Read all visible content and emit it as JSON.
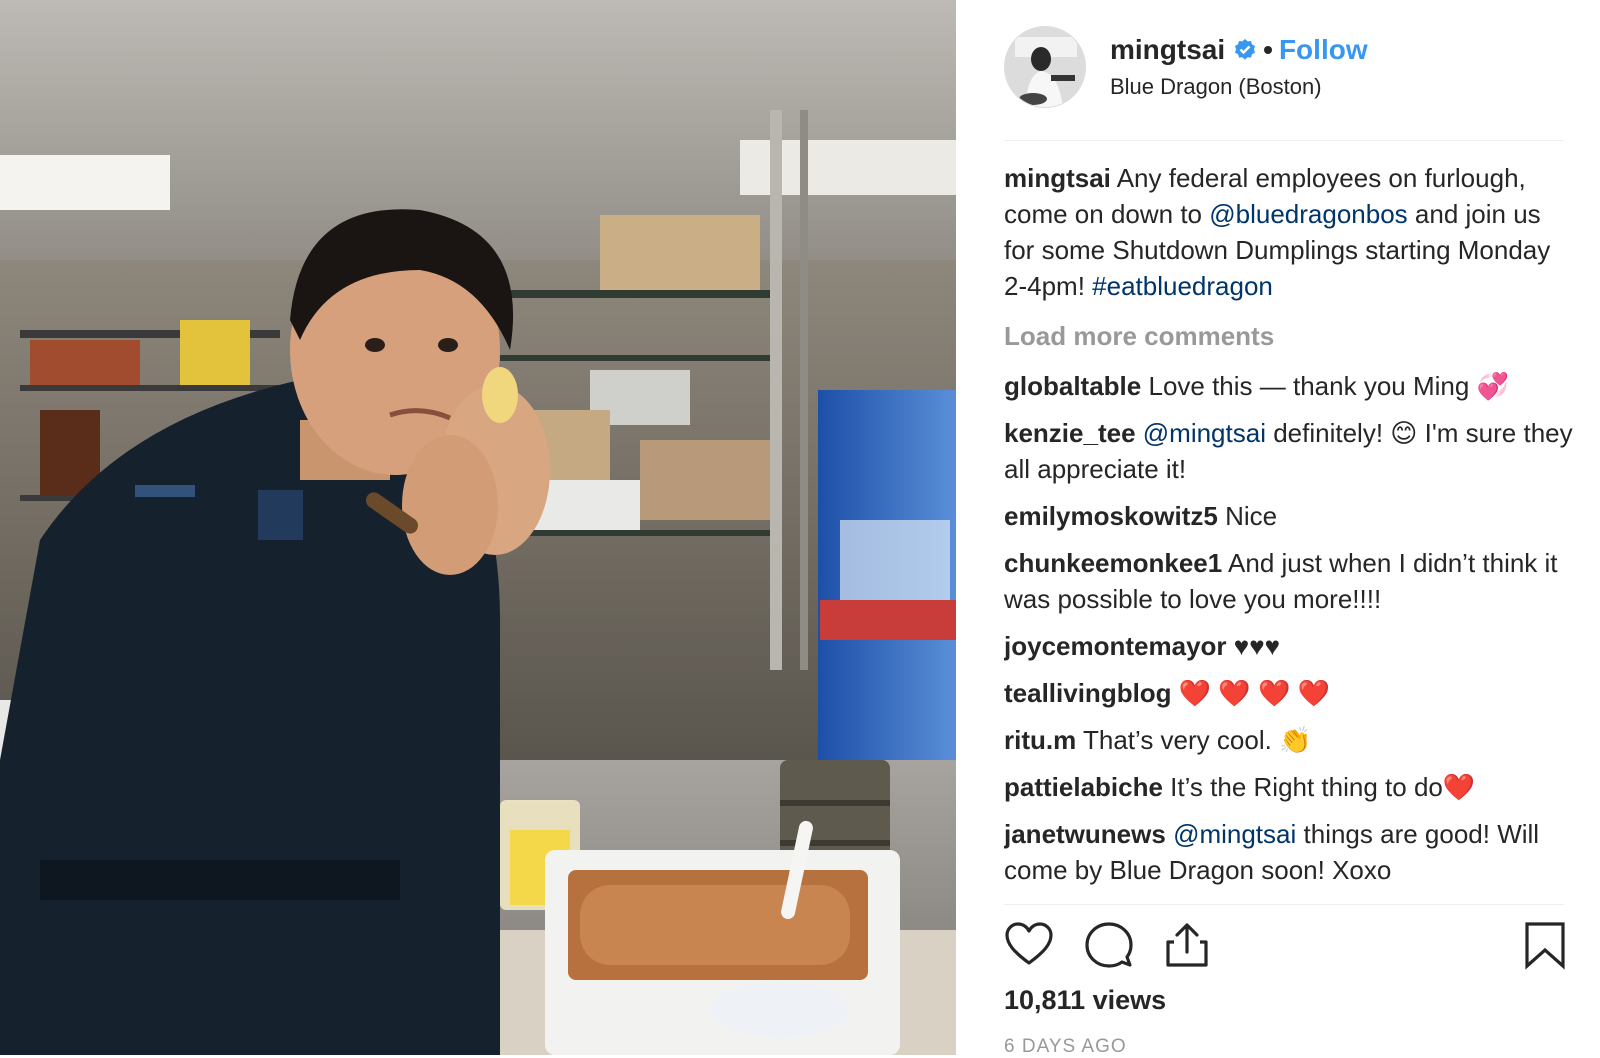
{
  "post": {
    "username": "mingtsai",
    "follow_label": "Follow",
    "location": "Blue Dragon (Boston)",
    "dot": "•"
  },
  "caption": {
    "username": "mingtsai",
    "text_1": "Any federal employees on furlough, come on down to",
    "mention": "@bluedragonbos",
    "text_2": "and join us for some Shutdown Dumplings starting Monday 2-4pm!",
    "hashtag": "#eatbluedragon"
  },
  "load_more_label": "Load more comments",
  "comments": [
    {
      "username": "globaltable",
      "text": "Love this — thank you Ming 💞"
    },
    {
      "username": "kenzie_tee",
      "mention": "@mingtsai",
      "text": "definitely! 😊  I'm sure they all appreciate it!"
    },
    {
      "username": "emilymoskowitz5",
      "text": "Nice"
    },
    {
      "username": "chunkeemonkee1",
      "text": "And just when I didn’t think it was possible to love you more!!!!"
    },
    {
      "username": "joycemontemayor",
      "text": "♥♥♥"
    },
    {
      "username": "teallivingblog",
      "text": "❤️ ❤️ ❤️ ❤️"
    },
    {
      "username": "ritu.m",
      "text": "That’s very cool. 👏"
    },
    {
      "username": "pattielabiche",
      "text": "It’s the Right thing to do❤️"
    },
    {
      "username": "janetwunews",
      "mention": "@mingtsai",
      "text": "things are good! Will come by Blue Dragon soon! Xoxo"
    }
  ],
  "stats": {
    "views": "10,811 views",
    "date": "6 DAYS AGO"
  },
  "icons": {
    "like": "heart-icon",
    "comment": "comment-bubble-icon",
    "share": "share-icon",
    "save": "bookmark-icon",
    "verified": "verified-badge-icon"
  },
  "colors": {
    "link_blue": "#3897f0",
    "mention_blue": "#003569",
    "muted": "#999999"
  }
}
